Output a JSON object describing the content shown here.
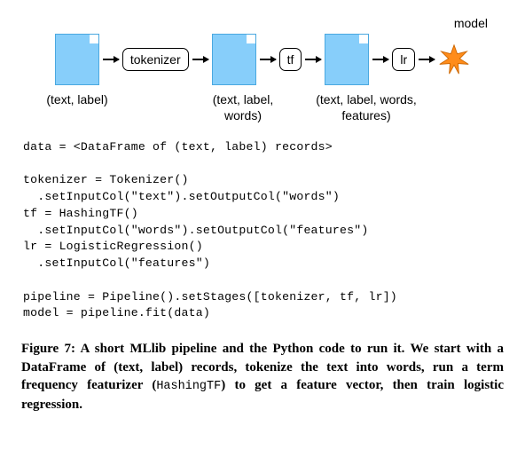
{
  "diagram": {
    "model_label": "model",
    "stages": [
      "tokenizer",
      "tf",
      "lr"
    ],
    "captions": [
      "(text, label)",
      "(text, label,\nwords)",
      "(text, label,\nwords, features)"
    ]
  },
  "code": "data = <DataFrame of (text, label) records>\n\ntokenizer = Tokenizer()\n  .setInputCol(\"text\").setOutputCol(\"words\")\ntf = HashingTF()\n  .setInputCol(\"words\").setOutputCol(\"features\")\nlr = LogisticRegression()\n  .setInputCol(\"features\")\n\npipeline = Pipeline().setStages([tokenizer, tf, lr])\nmodel = pipeline.fit(data)",
  "caption": {
    "fig_label": "Figure 7:",
    "text_before": " A short MLlib pipeline and the Python code to run it. We start with a DataFrame of (text, label) records, tokenize the text into words, run a term frequency featurizer (",
    "code_term": "HashingTF",
    "text_after": ") to get a feature vector, then train logistic regression."
  }
}
